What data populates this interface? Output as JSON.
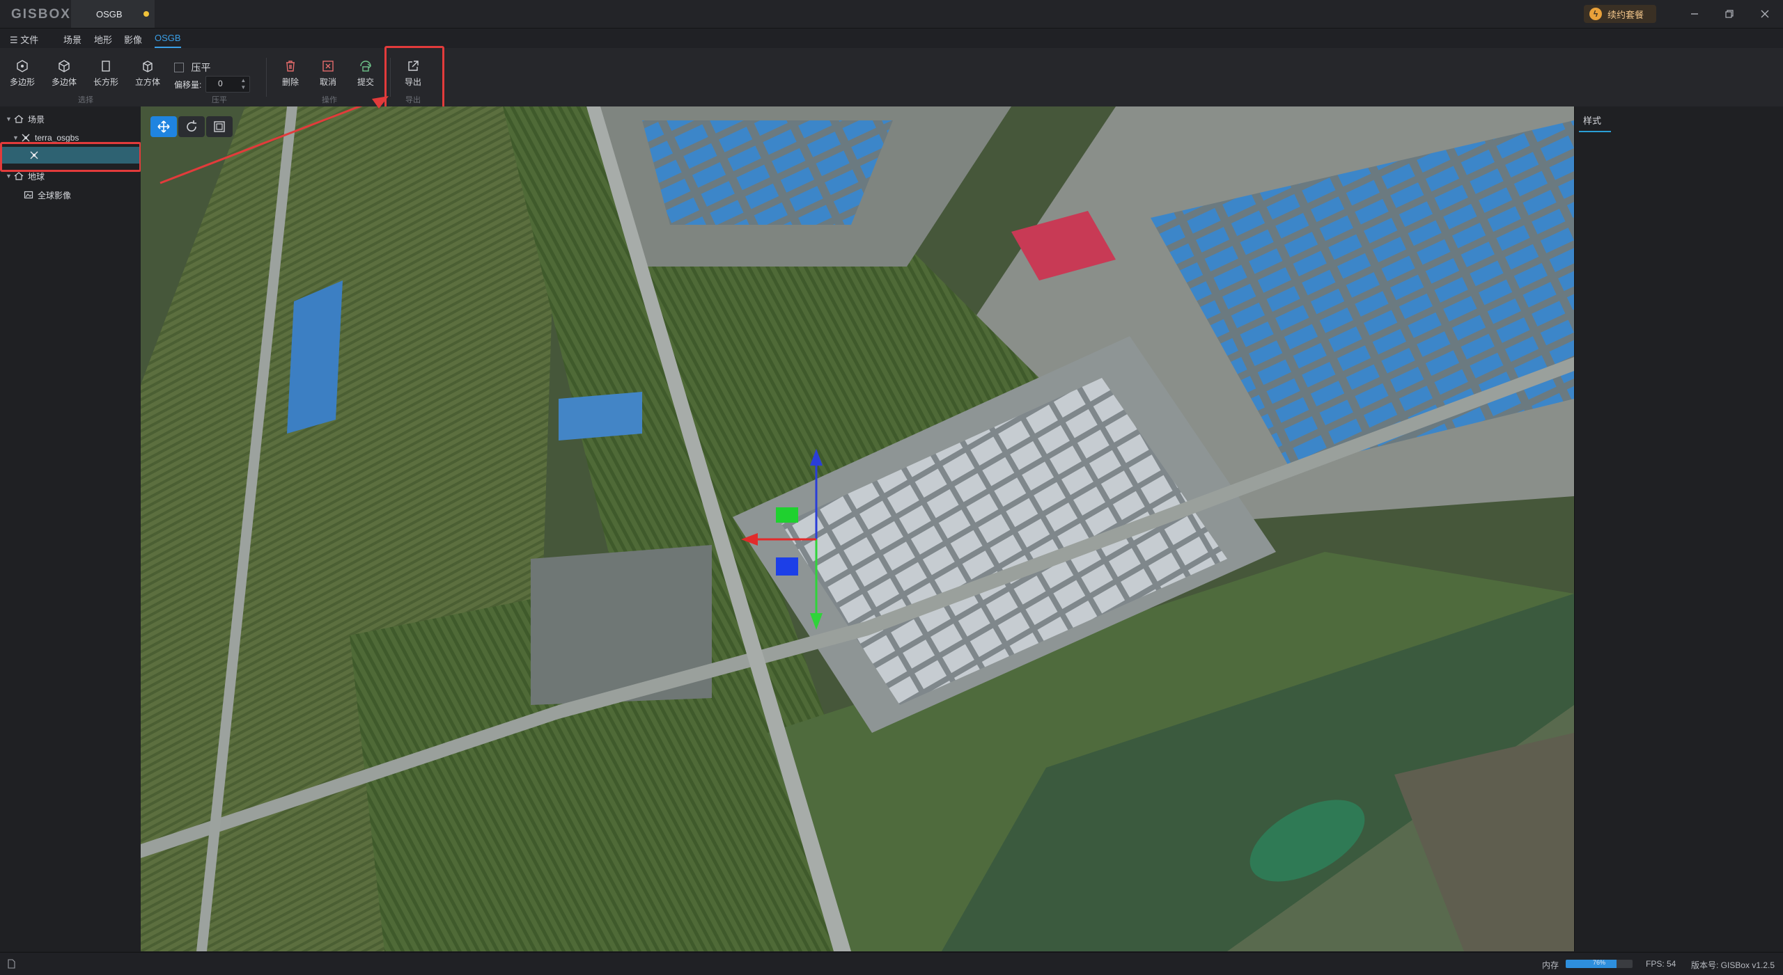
{
  "app": {
    "logo": "GISBOX"
  },
  "doc_tab": {
    "label": "OSGB",
    "unsaved": true
  },
  "vip": {
    "label": "续约套餐"
  },
  "menu": {
    "file": "文件",
    "items": [
      "场景",
      "地形",
      "影像",
      "OSGB"
    ],
    "active": "OSGB"
  },
  "toolbar": {
    "polygon": "多边形",
    "polyhedron": "多边体",
    "rectangle": "长方形",
    "cuboid": "立方体",
    "group_select": "选择",
    "flatten": "压平",
    "offset_label": "偏移量:",
    "offset_value": "0",
    "group_flatten": "压平",
    "delete": "删除",
    "cancel": "取消",
    "submit": "提交",
    "group_operate": "操作",
    "export": "导出",
    "group_export": "导出"
  },
  "tree": {
    "scene": "场景",
    "layer": "terra_osgbs",
    "earth": "地球",
    "imagery": "全球影像"
  },
  "right_panel": {
    "tab": "样式"
  },
  "status": {
    "memory_label": "内存",
    "memory_percent": 76,
    "memory_text": "76%",
    "fps": "FPS: 54",
    "version": "版本号: GISBox v1.2.5"
  },
  "colors": {
    "accent": "#1f84e0",
    "highlight": "#e23b3b",
    "selected_row": "#2e6272"
  },
  "icons": [
    "polygon-icon",
    "polyhedron-icon",
    "rectangle-icon",
    "cuboid-icon",
    "delete-icon",
    "cancel-icon",
    "submit-icon",
    "export-icon",
    "move-icon",
    "rotate-icon",
    "scale-icon",
    "gizmo"
  ]
}
